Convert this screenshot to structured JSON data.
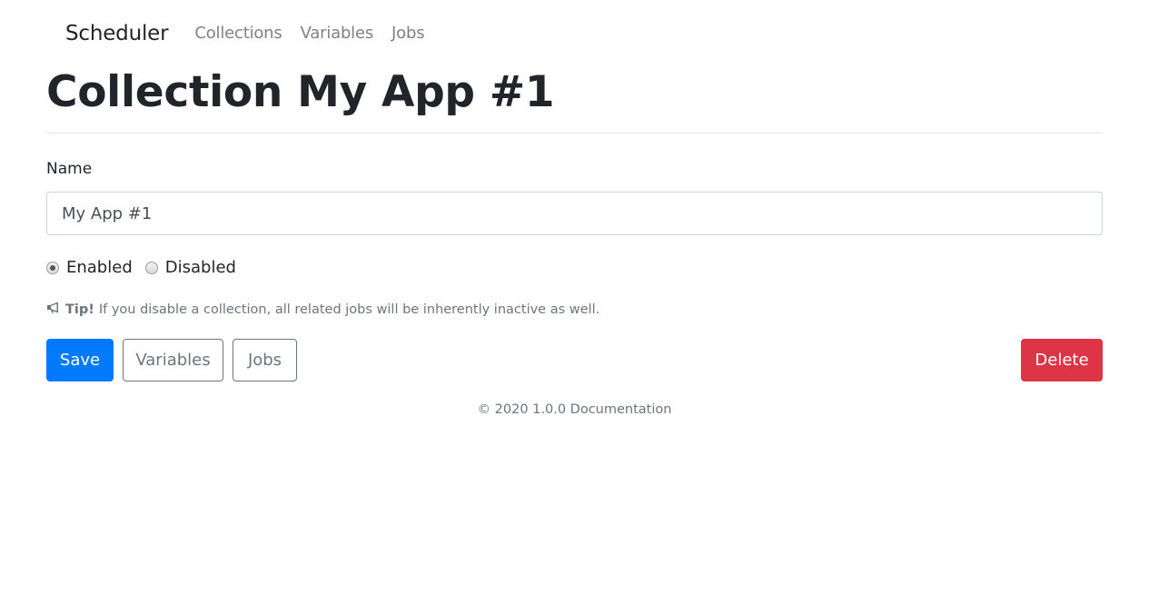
{
  "navbar": {
    "brand": "Scheduler",
    "links": [
      "Collections",
      "Variables",
      "Jobs"
    ]
  },
  "page": {
    "title": "Collection My App #1"
  },
  "form": {
    "name_label": "Name",
    "name_value": "My App #1",
    "status_options": [
      {
        "label": "Enabled",
        "checked": true
      },
      {
        "label": "Disabled",
        "checked": false
      }
    ],
    "tip": {
      "icon": "bullhorn-icon",
      "strong": "Tip!",
      "text": "If you disable a collection, all related jobs will be inherently inactive as well."
    }
  },
  "actions": {
    "save": "Save",
    "variables": "Variables",
    "jobs": "Jobs",
    "delete": "Delete"
  },
  "footer": {
    "text": "© 2020 1.0.0 Documentation"
  },
  "colors": {
    "primary": "#007bff",
    "danger": "#dc3545",
    "secondary": "#6c757d"
  }
}
